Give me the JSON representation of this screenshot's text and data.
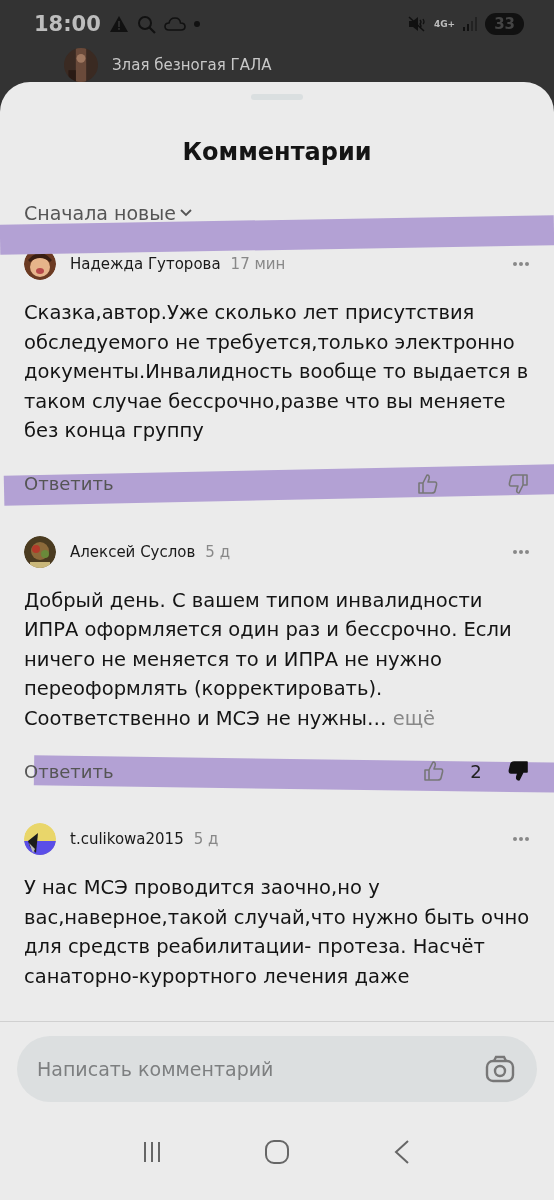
{
  "status_bar": {
    "time": "18:00",
    "network": "4G+",
    "battery": "33"
  },
  "background_page": {
    "title": "Злая безногая ГАЛА"
  },
  "sheet": {
    "title": "Комментарии",
    "sort": {
      "label": "Сначала новые",
      "highlighted": true
    }
  },
  "comments": [
    {
      "author": "Надежда Гуторова",
      "time": "17 мин",
      "text": "Сказка,автор.Уже сколько лет присутствия обследуемого не требуется,только электронно документы.Инвалидность вообще то выдается в таком случае бессрочно,разве что вы меняете без конца группу",
      "reply": "Ответить",
      "liked": false,
      "disliked": false,
      "highlighted": true
    },
    {
      "author": "Алексей Суслов",
      "time": "5 д",
      "text": "Добрый день. С вашем типом инвалидности ИПРА оформляется один раз и бессрочно. Если ничего не меняется то и ИПРА не нужно переоформлять (корректировать). Соответственно и МСЭ не нужны…",
      "more": "ещё",
      "reply": "Ответить",
      "liked": false,
      "disliked": true,
      "dislike_count": "2",
      "highlighted": true
    },
    {
      "author": "t.culikowa2015",
      "time": "5 д",
      "text": "У нас МСЭ проводится заочно,но у вас,наверное,такой случай,что нужно быть очно для средств реабилитации- протеза. Насчёт санаторно-курортного лечения даже"
    }
  ],
  "composer": {
    "placeholder": "Написать комментарий"
  }
}
